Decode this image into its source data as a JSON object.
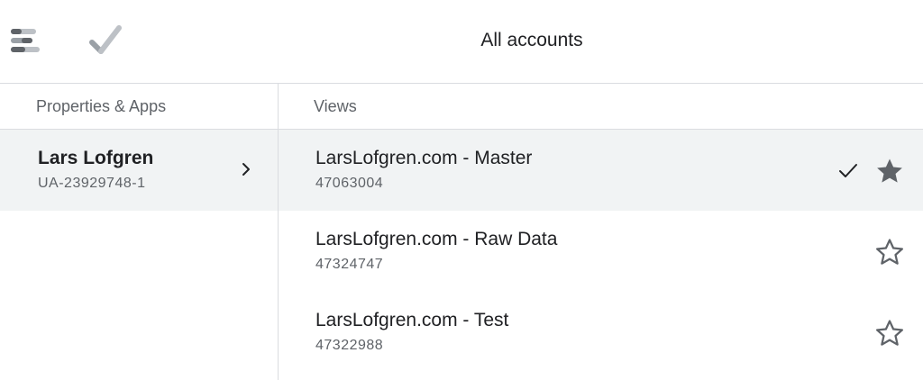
{
  "header": {
    "title": "All accounts"
  },
  "icons": {
    "logo": "analytics-logo-icon",
    "check_logo": "checkmark-logo-icon",
    "chevron": "chevron-right-icon",
    "selected_check": "check-icon",
    "star_filled": "star-filled-icon",
    "star_outline": "star-outline-icon"
  },
  "colors": {
    "selected_row_bg": "#f1f3f4",
    "icon_gray": "#5f6368",
    "divider": "#dadce0"
  },
  "properties": {
    "header": "Properties & Apps",
    "items": [
      {
        "name": "Lars Lofgren",
        "id": "UA-23929748-1",
        "selected": true
      }
    ]
  },
  "views": {
    "header": "Views",
    "items": [
      {
        "name": "LarsLofgren.com - Master",
        "id": "47063004",
        "selected": true,
        "starred": true
      },
      {
        "name": "LarsLofgren.com - Raw Data",
        "id": "47324747",
        "selected": false,
        "starred": false
      },
      {
        "name": "LarsLofgren.com - Test",
        "id": "47322988",
        "selected": false,
        "starred": false
      }
    ]
  }
}
